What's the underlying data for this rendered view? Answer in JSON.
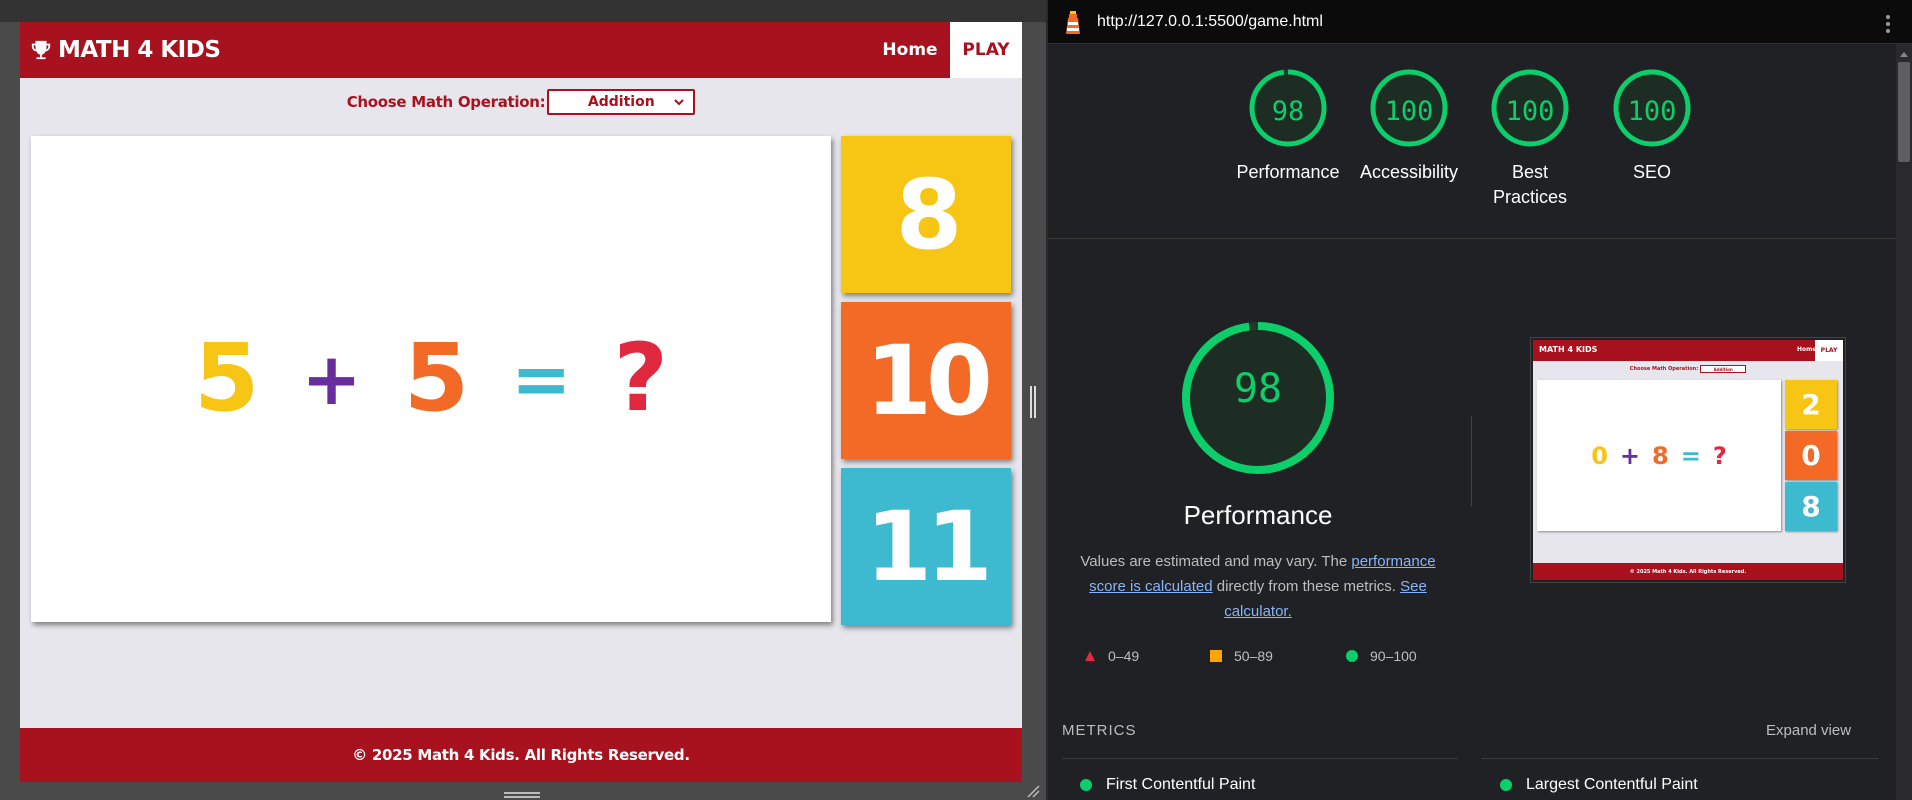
{
  "game": {
    "brand": "MATH 4 KIDS",
    "nav": {
      "home": "Home",
      "play": "PLAY"
    },
    "operation_label": "Choose Math Operation:",
    "operation_selected": "Addition",
    "equation": {
      "left": "5",
      "operator": "+",
      "right": "5",
      "equals": "=",
      "unknown": "?"
    },
    "answers": [
      "8",
      "10",
      "11"
    ],
    "footer": "© 2025 Math 4 Kids. All Rights Reserved.",
    "colors": {
      "brand_red": "#a8121f",
      "yellow": "#f7c513",
      "orange": "#f26a25",
      "teal": "#3ebad0",
      "purple": "#6a2e9c",
      "red": "#e0293f"
    }
  },
  "lighthouse": {
    "url": "http://127.0.0.1:5500/game.html",
    "scores": [
      {
        "label": "Performance",
        "value": "98",
        "score": 0.98
      },
      {
        "label": "Accessibility",
        "value": "100",
        "score": 1.0
      },
      {
        "label": "Best Practices",
        "value": "100",
        "score": 1.0
      },
      {
        "label": "SEO",
        "value": "100",
        "score": 1.0
      }
    ],
    "main": {
      "value": "98",
      "score": 0.98,
      "title": "Performance",
      "desc_pre": "Values are estimated and may vary. The ",
      "desc_link1": "performance score is calculated",
      "desc_mid": " directly from these metrics. ",
      "desc_link2": "See calculator."
    },
    "legend": [
      {
        "range": "0–49",
        "color": "#e0293f"
      },
      {
        "range": "50–89",
        "color": "#ffa400"
      },
      {
        "range": "90–100",
        "color": "#0cce6b"
      }
    ],
    "screenshot": {
      "brand": "MATH 4 KIDS",
      "home": "Home",
      "play": "PLAY",
      "op_label": "Choose Math Operation:",
      "op_selected": "Addition",
      "equation": [
        "0",
        "+",
        "8",
        "=",
        "?"
      ],
      "answers": [
        "2",
        "0",
        "8"
      ],
      "footer": "© 2025 Math 4 Kids. All Rights Reserved."
    },
    "metrics_title": "METRICS",
    "expand_view": "Expand view",
    "metrics": [
      "First Contentful Paint",
      "Largest Contentful Paint"
    ],
    "pass_color": "#0cce6b"
  }
}
